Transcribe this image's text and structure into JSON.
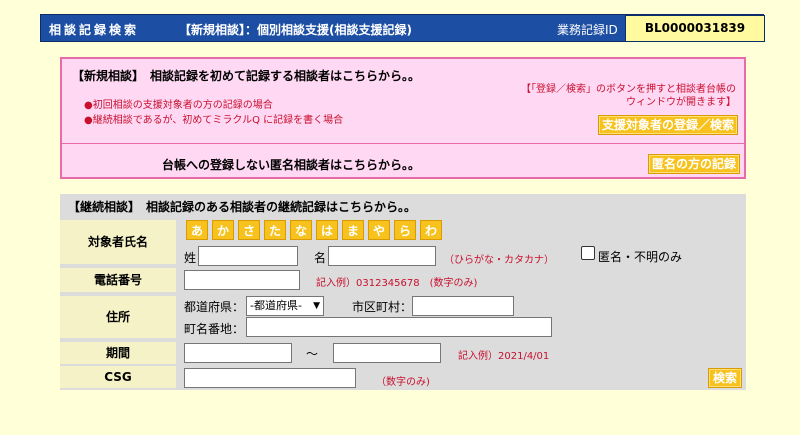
{
  "header": {
    "app_title": "相談記録検索",
    "subtitle": "【新規相談】：個別相談支援(相談支援記録)",
    "record_id_label": "業務記録ID",
    "record_id_value": "BL0000031839"
  },
  "new_consultation": {
    "title": "【新規相談】　相談記録を初めて記録する相談者はこちらから。。",
    "bullet1": "●初回相談の支援対象者の方の記録の場合",
    "bullet2": "●継続相談であるが、初めてミラクルQ に記録を書く場合",
    "note_line1": "【「登録／検索」のボタンを押すと相談者台帳の",
    "note_line2": "ウィンドウが開きます】",
    "register_button": "支援対象者の登録／検索",
    "anon_text": "台帳への登録しない匿名相談者はこちらから。。",
    "anon_button": "匿名の方の記録"
  },
  "continuing": {
    "title": "【継続相談】　相談記録のある相談者の継続記録はこちらから。。",
    "kana": [
      "あ",
      "か",
      "さ",
      "た",
      "な",
      "は",
      "ま",
      "や",
      "ら",
      "わ"
    ],
    "name_label": "対象者氏名",
    "surname_label": "姓",
    "given_label": "名",
    "name_hint": "（ひらがな・カタカナ）",
    "anon_checkbox_label": "匿名・不明のみ",
    "phone_label": "電話番号",
    "phone_hint": "記入例）0312345678　(数字のみ)",
    "address_label": "住所",
    "prefecture_label": "都道府県：",
    "prefecture_selected": "-都道府県-",
    "city_label": "市区町村：",
    "town_label": "町名番地：",
    "period_label": "期間",
    "period_sep": "〜",
    "period_hint": "記入例）2021/4/01",
    "csg_label": "CSG",
    "csg_hint": "（数字のみ)",
    "search_button": "検索"
  }
}
